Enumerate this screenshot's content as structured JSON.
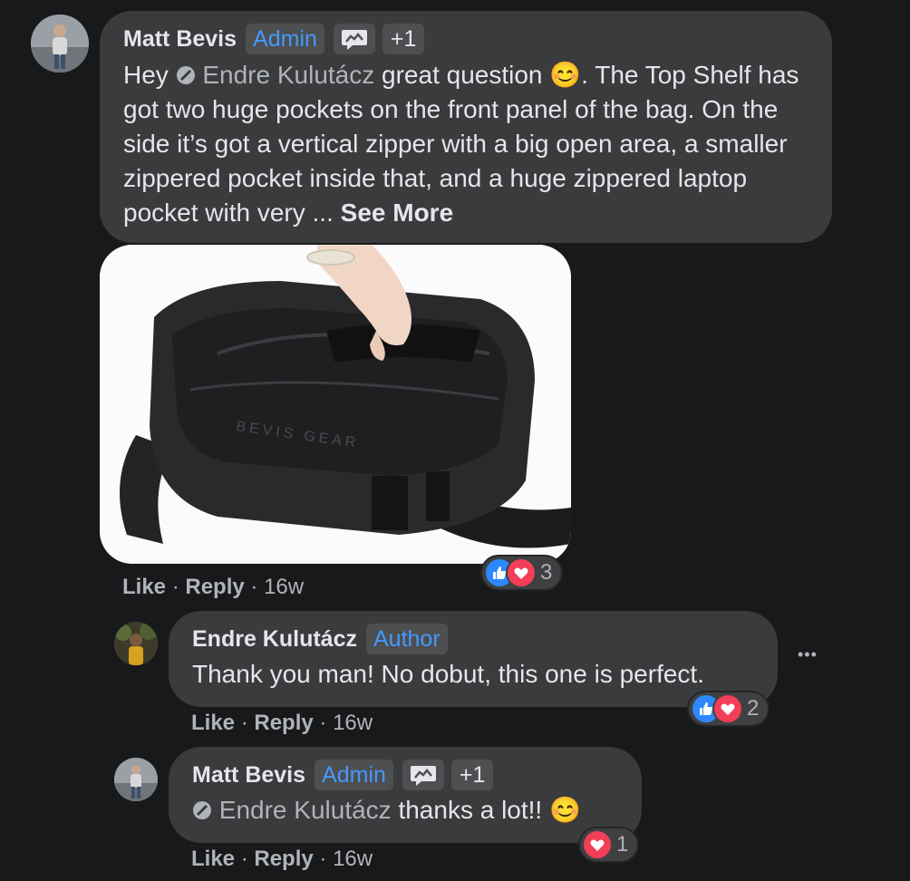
{
  "comment1": {
    "author": "Matt Bevis",
    "badge": "Admin",
    "badge_extra": "+1",
    "text_before": "Hey",
    "mention": "Endre Kulutácz",
    "text_after_mention": "great question",
    "text_rest": ". The Top Shelf has got two huge pockets on the front panel of the bag. On the side it’s got a vertical zipper with a big open area, a smaller zippered pocket inside that, and a huge zippered laptop pocket with very ...",
    "see_more": "See More",
    "emoji": "😊",
    "image_label": "BEVIS GEAR",
    "like": "Like",
    "reply": "Reply",
    "time": "16w",
    "reaction_count": "3"
  },
  "comment2": {
    "author": "Endre Kulutácz",
    "badge": "Author",
    "text": "Thank you man! No dobut, this one is perfect.",
    "like": "Like",
    "reply": "Reply",
    "time": "16w",
    "reaction_count": "2",
    "more_icon": "•••"
  },
  "comment3": {
    "author": "Matt Bevis",
    "badge": "Admin",
    "badge_extra": "+1",
    "mention": "Endre Kulutácz",
    "text": "thanks a lot!!",
    "emoji": "😊",
    "like": "Like",
    "reply": "Reply",
    "time": "16w",
    "reaction_count": "1"
  },
  "separator": "·",
  "colors": {
    "background": "#18191a",
    "bubble": "#3a3b3c",
    "badge_text": "#4599ff",
    "like_blue": "#2d88ff",
    "love_red": "#f33e58"
  }
}
